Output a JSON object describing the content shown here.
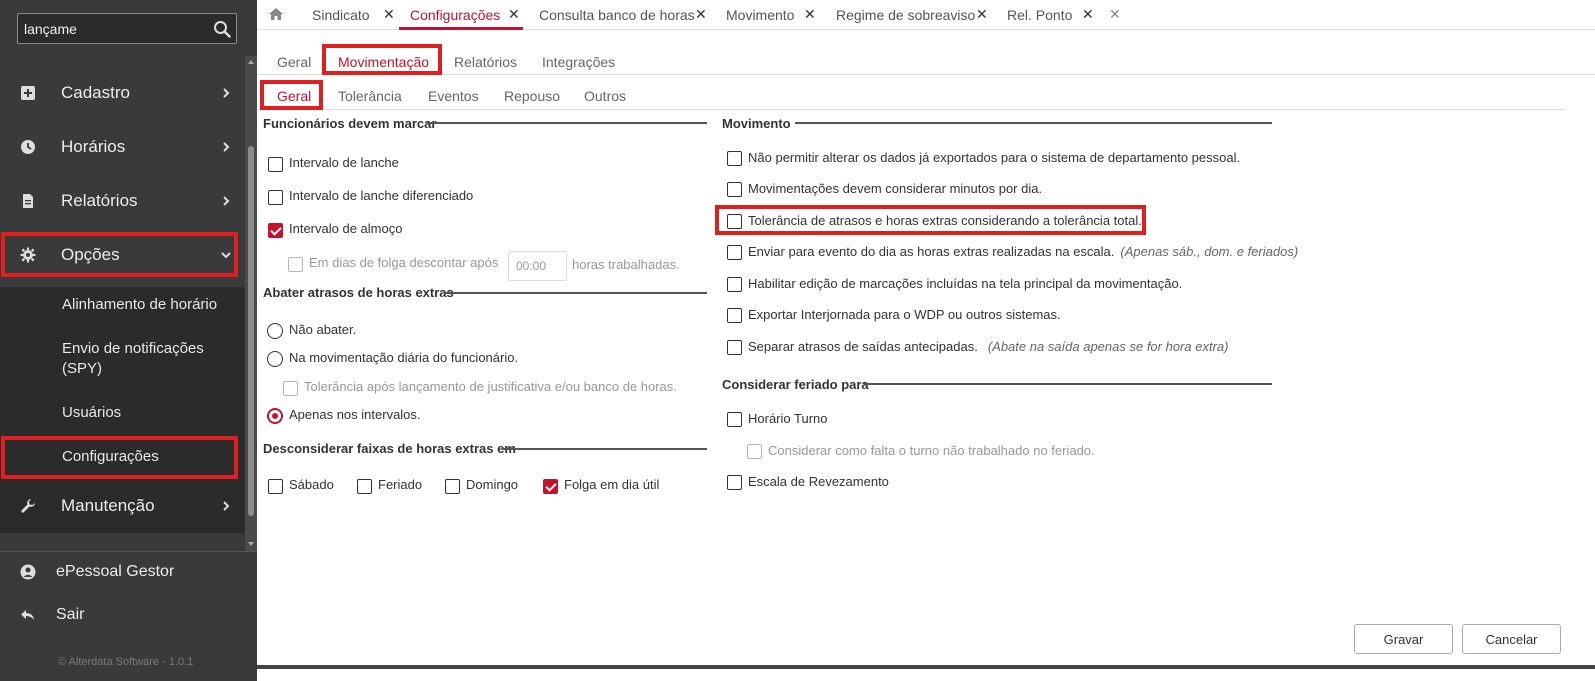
{
  "sidebar": {
    "search": {
      "value": "lançame",
      "icon": "search-icon"
    },
    "items": [
      {
        "label": "Cadastro",
        "icon": "plus-square-icon"
      },
      {
        "label": "Horários",
        "icon": "clock-icon"
      },
      {
        "label": "Relatórios",
        "icon": "document-icon"
      },
      {
        "label": "Opções",
        "icon": "gear-icon"
      },
      {
        "label": "Manutenção",
        "icon": "wrench-icon"
      }
    ],
    "submenu": [
      {
        "label": "Alinhamento de horário"
      },
      {
        "label": "Envio de notificações (SPY)"
      },
      {
        "label": "Usuários"
      },
      {
        "label": "Configurações"
      }
    ],
    "footer": [
      {
        "label": "ePessoal Gestor",
        "icon": "user-circle-icon"
      },
      {
        "label": "Sair",
        "icon": "reply-icon"
      }
    ],
    "copyright": "© Alterdata Software - 1.0.1"
  },
  "tabs": [
    {
      "label": "Sindicato",
      "active": false
    },
    {
      "label": "Configurações",
      "active": true
    },
    {
      "label": "Consulta banco de horas",
      "active": false
    },
    {
      "label": "Movimento",
      "active": false
    },
    {
      "label": "Regime de sobreaviso",
      "active": false
    },
    {
      "label": "Rel. Ponto",
      "active": false
    }
  ],
  "top_tabs": [
    "Geral",
    "Movimentação",
    "Relatórios",
    "Integrações"
  ],
  "sub_tabs": [
    "Geral",
    "Tolerância",
    "Eventos",
    "Repouso",
    "Outros"
  ],
  "left": {
    "funcionarios": {
      "title": "Funcionários devem marcar",
      "options": [
        {
          "label": "Intervalo de lanche",
          "checked": false
        },
        {
          "label": "Intervalo de lanche diferenciado",
          "checked": false
        },
        {
          "label": "Intervalo de almoço",
          "checked": true
        }
      ],
      "folga_prefix": "Em dias de folga descontar após",
      "folga_value": "00:00",
      "folga_suffix": "horas trabalhadas."
    },
    "abater": {
      "title": "Abater atrasos de horas extras",
      "options": [
        {
          "label": "Não abater.",
          "checked": false
        },
        {
          "label": "Na movimentação diária do funcionário.",
          "checked": false
        },
        {
          "label": "Apenas nos intervalos.",
          "checked": true
        }
      ],
      "tolerancia": "Tolerância após lançamento de justificativa e/ou banco de horas."
    },
    "desconsiderar": {
      "title": "Desconsiderar faixas de horas extras em",
      "options": [
        {
          "label": "Sábado",
          "checked": false
        },
        {
          "label": "Feriado",
          "checked": false
        },
        {
          "label": "Domingo",
          "checked": false
        },
        {
          "label": "Folga em dia útil",
          "checked": true
        }
      ]
    }
  },
  "right": {
    "movimento": {
      "title": "Movimento",
      "options": [
        {
          "label": "Não permitir alterar os dados já exportados para o sistema de departamento pessoal.",
          "note": ""
        },
        {
          "label": "Movimentações devem considerar minutos por dia.",
          "note": ""
        },
        {
          "label": "Tolerância de atrasos e horas extras considerando a tolerância total.",
          "note": ""
        },
        {
          "label": "Enviar para evento do dia as horas extras realizadas na escala.",
          "note": "(Apenas sáb., dom. e feriados)"
        },
        {
          "label": "Habilitar edição de marcações incluídas na tela principal da movimentação.",
          "note": ""
        },
        {
          "label": "Exportar Interjornada para o WDP ou outros sistemas.",
          "note": ""
        },
        {
          "label": "Separar atrasos de saídas antecipadas.",
          "note": "(Abate na saída apenas se for hora extra)"
        }
      ]
    },
    "feriado": {
      "title": "Considerar feriado para",
      "options": [
        {
          "label": "Horário Turno"
        },
        {
          "label": "Considerar como falta o turno não trabalhado no feriado."
        },
        {
          "label": "Escala de Revezamento"
        }
      ]
    }
  },
  "buttons": {
    "save": "Gravar",
    "cancel": "Cancelar"
  },
  "colors": {
    "accent": "#c8102e",
    "highlight": "#e02020",
    "sidebar": "#3a3a3a"
  }
}
